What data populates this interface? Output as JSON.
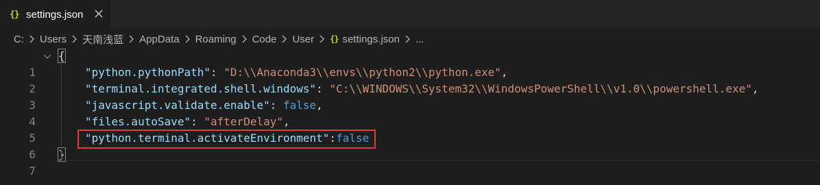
{
  "tab": {
    "icon": "{}",
    "label": "settings.json",
    "close_icon": "close-icon"
  },
  "breadcrumb": {
    "items": [
      "C:",
      "Users",
      "天南浅蓝",
      "AppData",
      "Roaming",
      "Code",
      "User"
    ],
    "file_icon": "{}",
    "file": "settings.json",
    "trailing": "..."
  },
  "editor": {
    "lines": [
      {
        "number": "1",
        "brace": "{"
      },
      {
        "number": "2",
        "key": "\"python.pythonPath\"",
        "colon": ": ",
        "value": "\"D:\\\\Anaconda3\\\\envs\\\\python2\\\\python.exe\"",
        "comma": ","
      },
      {
        "number": "3",
        "key": "\"terminal.integrated.shell.windows\"",
        "colon": ": ",
        "value": "\"C:\\\\WINDOWS\\\\System32\\\\WindowsPowerShell\\\\v1.0\\\\powershell.exe\"",
        "comma": ","
      },
      {
        "number": "4",
        "key": "\"javascript.validate.enable\"",
        "colon": ": ",
        "value": "false",
        "comma": ","
      },
      {
        "number": "5",
        "key": "\"files.autoSave\"",
        "colon": ": ",
        "value": "\"afterDelay\"",
        "comma": ","
      },
      {
        "number": "6",
        "key": "\"python.terminal.activateEnvironment\"",
        "colon": ":",
        "value": "false",
        "comma": ""
      },
      {
        "number": "7",
        "brace": "}"
      }
    ]
  },
  "colors": {
    "background": "#1e1e1e",
    "key": "#9cdcfe",
    "string": "#ce9178",
    "keyword": "#569cd6",
    "highlight_border": "#e03a3a",
    "json_icon": "#cbcb41"
  }
}
